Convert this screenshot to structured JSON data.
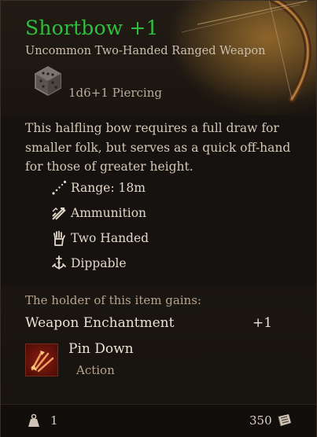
{
  "item": {
    "name": "Shortbow +1",
    "subtitle": "Uncommon Two-Handed Ranged Weapon",
    "damage": "1d6+1 Piercing",
    "description": "This halfling bow requires a full draw for smaller folk, but serves as a quick off-hand for those of greater height.",
    "properties": [
      {
        "icon": "range-icon",
        "label": "Range: 18m"
      },
      {
        "icon": "ammunition-icon",
        "label": "Ammunition"
      },
      {
        "icon": "two-handed-icon",
        "label": "Two Handed"
      },
      {
        "icon": "dippable-icon",
        "label": "Dippable"
      }
    ]
  },
  "bonuses": {
    "heading": "The holder of this item gains:",
    "enchantment_label": "Weapon Enchantment",
    "enchantment_value": "+1",
    "action": {
      "name": "Pin Down",
      "type": "Action",
      "icon": "pin-down-icon"
    }
  },
  "footer": {
    "weight": "1",
    "weight_icon": "weight-icon",
    "price": "350",
    "price_icon": "gold-coin-icon"
  },
  "colors": {
    "rarity_uncommon": "#2fbf3e",
    "background": "#16120f",
    "text": "#d3c7b6"
  }
}
